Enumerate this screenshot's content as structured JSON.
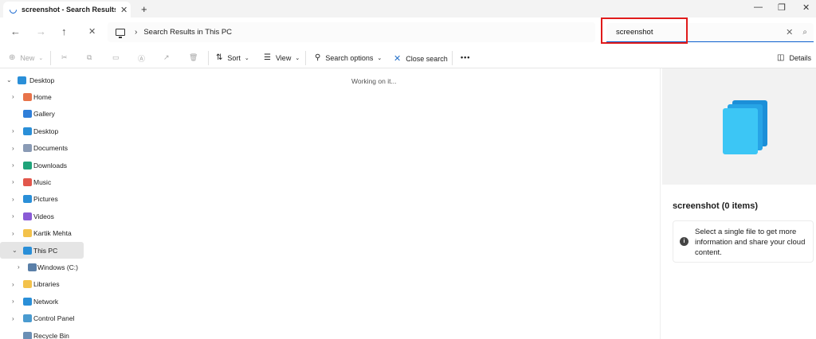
{
  "tab": {
    "title": "screenshot - Search Results in T",
    "close": "✕",
    "new": "+"
  },
  "window": {
    "minimize": "—",
    "restore": "❐",
    "close": "✕"
  },
  "nav": {
    "back": "←",
    "forward": "→",
    "up": "↑",
    "stop": "✕"
  },
  "address": {
    "crumb": "Search Results in This PC",
    "chevron": "›"
  },
  "search": {
    "value": "screenshot",
    "clear": "✕",
    "icon": "⌕"
  },
  "commands": {
    "new": "New",
    "sort": "Sort",
    "view": "View",
    "search_options": "Search options",
    "close_search": "Close search",
    "more": "•••",
    "details": "Details"
  },
  "sidebar": {
    "items": [
      {
        "label": "Desktop",
        "icon": "desktop-icon",
        "color": "#2a8fd8"
      },
      {
        "label": "Home",
        "icon": "home-icon",
        "color": "#e8734a"
      },
      {
        "label": "Gallery",
        "icon": "gallery-icon",
        "color": "#2f7fd9"
      },
      {
        "label": "Desktop",
        "icon": "desktop-icon",
        "color": "#2a8fd8"
      },
      {
        "label": "Documents",
        "icon": "documents-icon",
        "color": "#8a9bb5"
      },
      {
        "label": "Downloads",
        "icon": "downloads-icon",
        "color": "#1fa37a"
      },
      {
        "label": "Music",
        "icon": "music-icon",
        "color": "#e2574c"
      },
      {
        "label": "Pictures",
        "icon": "pictures-icon",
        "color": "#2a8fd8"
      },
      {
        "label": "Videos",
        "icon": "videos-icon",
        "color": "#8a5bd6"
      },
      {
        "label": "Kartik Mehta",
        "icon": "folder-icon",
        "color": "#f3c24b"
      },
      {
        "label": "This PC",
        "icon": "this-pc-icon",
        "color": "#2a8fd8"
      },
      {
        "label": "Windows (C:)",
        "icon": "drive-icon",
        "color": "#5a7fa8"
      },
      {
        "label": "Libraries",
        "icon": "libraries-icon",
        "color": "#f3c24b"
      },
      {
        "label": "Network",
        "icon": "network-icon",
        "color": "#2a8fd8"
      },
      {
        "label": "Control Panel",
        "icon": "control-panel-icon",
        "color": "#4a9bd0"
      },
      {
        "label": "Recycle Bin",
        "icon": "recycle-bin-icon",
        "color": "#6a8fb5"
      }
    ]
  },
  "main": {
    "status": "Working on it..."
  },
  "details": {
    "title": "screenshot (0 items)",
    "info": "Select a single file to get more information and share your cloud content.",
    "info_icon": "i"
  },
  "colors": {
    "accent": "#0b5fce",
    "highlight": "#e01b1b",
    "stack": "#2bb3ee"
  }
}
